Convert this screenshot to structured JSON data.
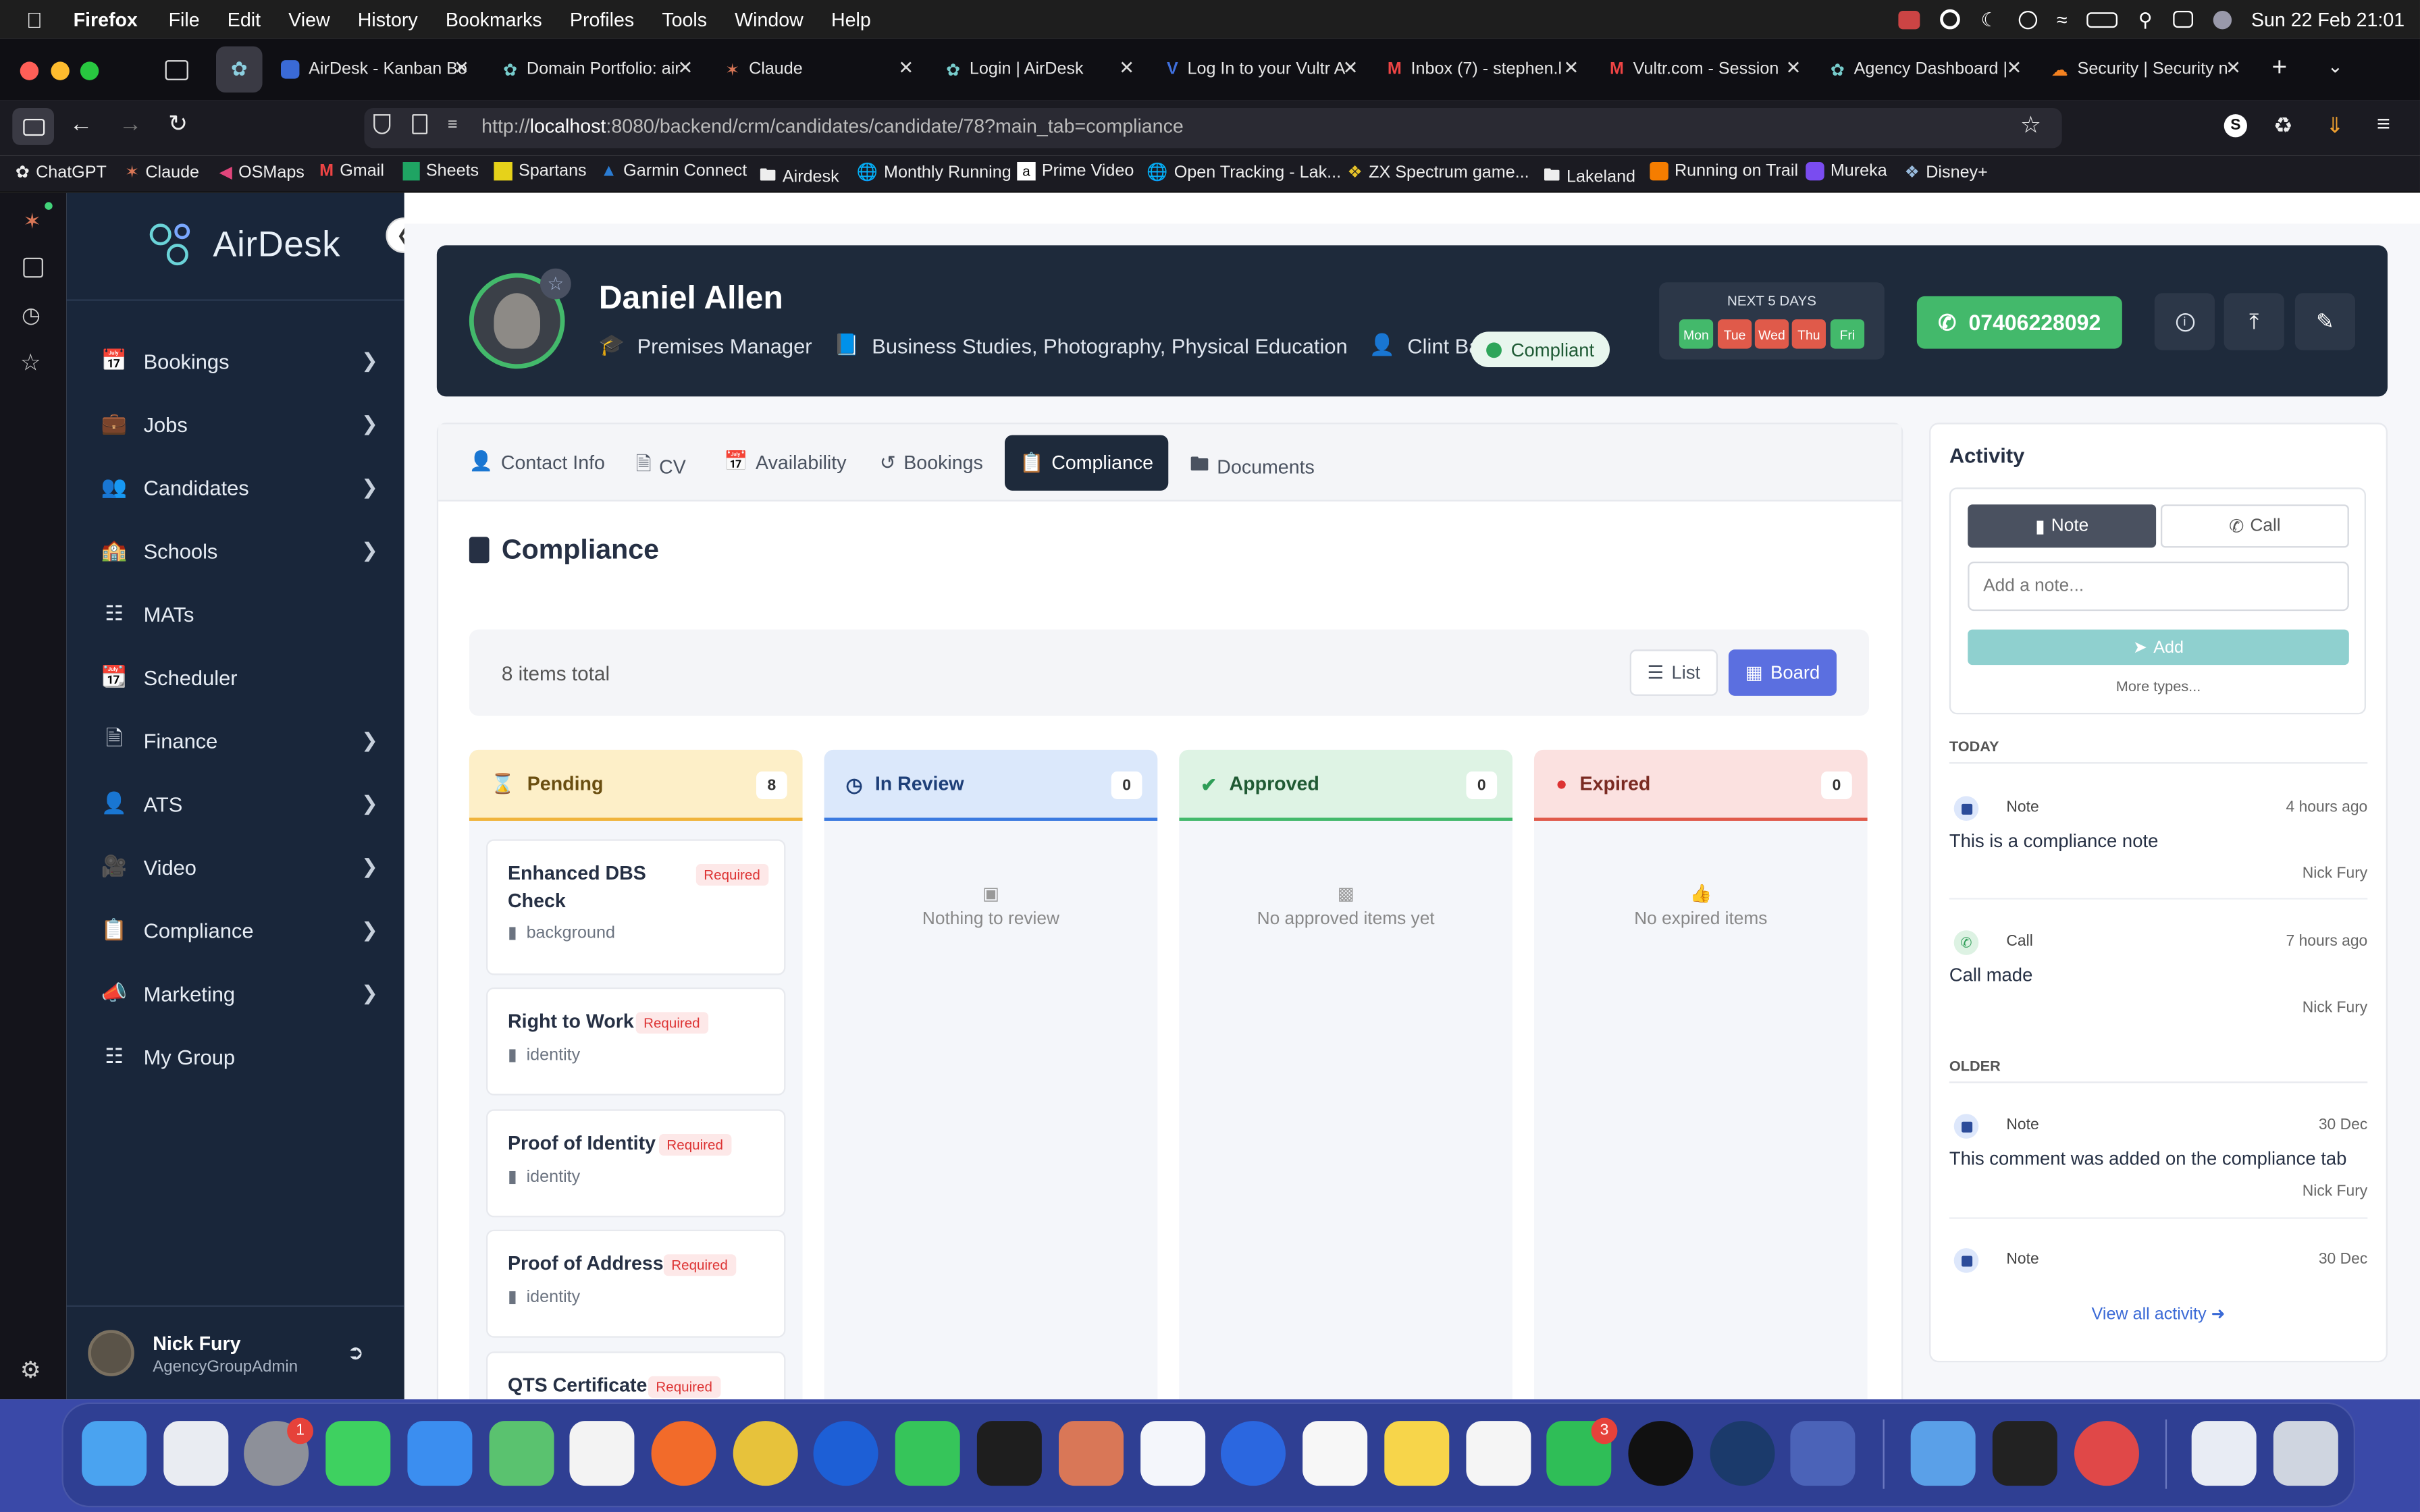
{
  "menubar": {
    "app": "Firefox",
    "items": [
      "File",
      "Edit",
      "View",
      "History",
      "Bookmarks",
      "Profiles",
      "Tools",
      "Window",
      "Help"
    ],
    "clock": "Sun 22 Feb  21:01"
  },
  "tabs": [
    "AirDesk - Kanban Bo",
    "Domain Portfolio: air",
    "Claude",
    "Login | AirDesk",
    "Log In to your Vultr A",
    "Inbox (7) - stephen.l",
    "Vultr.com - Session",
    "Agency Dashboard |",
    "Security | Security n"
  ],
  "url": {
    "prefix": "http://",
    "host": "localhost",
    "rest": ":8080/backend/crm/candidates/candidate/78?main_tab=compliance"
  },
  "bookmarks": [
    "ChatGPT",
    "Claude",
    "OSMaps",
    "Gmail",
    "Sheets",
    "Spartans",
    "Garmin Connect",
    "Airdesk",
    "Monthly Running",
    "Prime Video",
    "Open Tracking - Lak...",
    "ZX Spectrum game...",
    "Lakeland",
    "Running on Trail",
    "Mureka",
    "Disney+"
  ],
  "logo": "AirDesk",
  "nav": [
    "Bookings",
    "Jobs",
    "Candidates",
    "Schools",
    "MATs",
    "Scheduler",
    "Finance",
    "ATS",
    "Video",
    "Compliance",
    "Marketing",
    "My Group"
  ],
  "user": {
    "name": "Nick Fury",
    "role": "AgencyGroupAdmin"
  },
  "candidate": {
    "name": "Daniel Allen",
    "role": "Premises Manager",
    "subjects": "Business Studies, Photography, Physical Education",
    "owner": "Clint Barton",
    "status": "Compliant",
    "next_label": "NEXT 5 DAYS",
    "days": [
      "Mon",
      "Tue",
      "Wed",
      "Thu",
      "Fri"
    ],
    "phone": "07406228092"
  },
  "tabs_main": [
    "Contact Info",
    "CV",
    "Availability",
    "Bookings",
    "Compliance",
    "Documents"
  ],
  "section_title": "Compliance",
  "items_total": "8 items total",
  "view": {
    "list": "List",
    "board": "Board"
  },
  "columns": [
    {
      "title": "Pending",
      "count": "8"
    },
    {
      "title": "In Review",
      "count": "0",
      "empty": "Nothing to review"
    },
    {
      "title": "Approved",
      "count": "0",
      "empty": "No approved items yet"
    },
    {
      "title": "Expired",
      "count": "0",
      "empty": "No expired items"
    }
  ],
  "pending_cards": [
    {
      "title1": "Enhanced DBS",
      "title2": "Check",
      "badge": "Required",
      "sub": "background"
    },
    {
      "title1": "Right to Work",
      "badge": "Required",
      "sub": "identity"
    },
    {
      "title1": "Proof of Identity",
      "badge": "Required",
      "sub": "identity"
    },
    {
      "title1": "Proof of Address",
      "badge": "Required",
      "sub": "identity"
    },
    {
      "title1": "QTS Certificate",
      "badge": "Required"
    }
  ],
  "activity": {
    "title": "Activity",
    "note_btn": "Note",
    "call_btn": "Call",
    "placeholder": "Add a note...",
    "add": "Add",
    "more": "More types...",
    "today": "TODAY",
    "older": "OLDER",
    "items": [
      {
        "type": "Note",
        "time": "4 hours ago",
        "text": "This is a compliance note",
        "by": "Nick Fury"
      },
      {
        "type": "Call",
        "time": "7 hours ago",
        "text": "Call made",
        "by": "Nick Fury"
      },
      {
        "type": "Note",
        "time": "30 Dec",
        "text": "This comment was added on the compliance tab",
        "by": "Nick Fury"
      },
      {
        "type": "Note",
        "time": "30 Dec"
      }
    ],
    "view_all": "View all activity"
  },
  "dock_badges": {
    "settings": "1",
    "whatsapp": "3"
  },
  "colors": {
    "sidebar": "#19263a",
    "header": "#1e2a3b",
    "accent": "#5b6fe0",
    "green": "#43b96b"
  }
}
